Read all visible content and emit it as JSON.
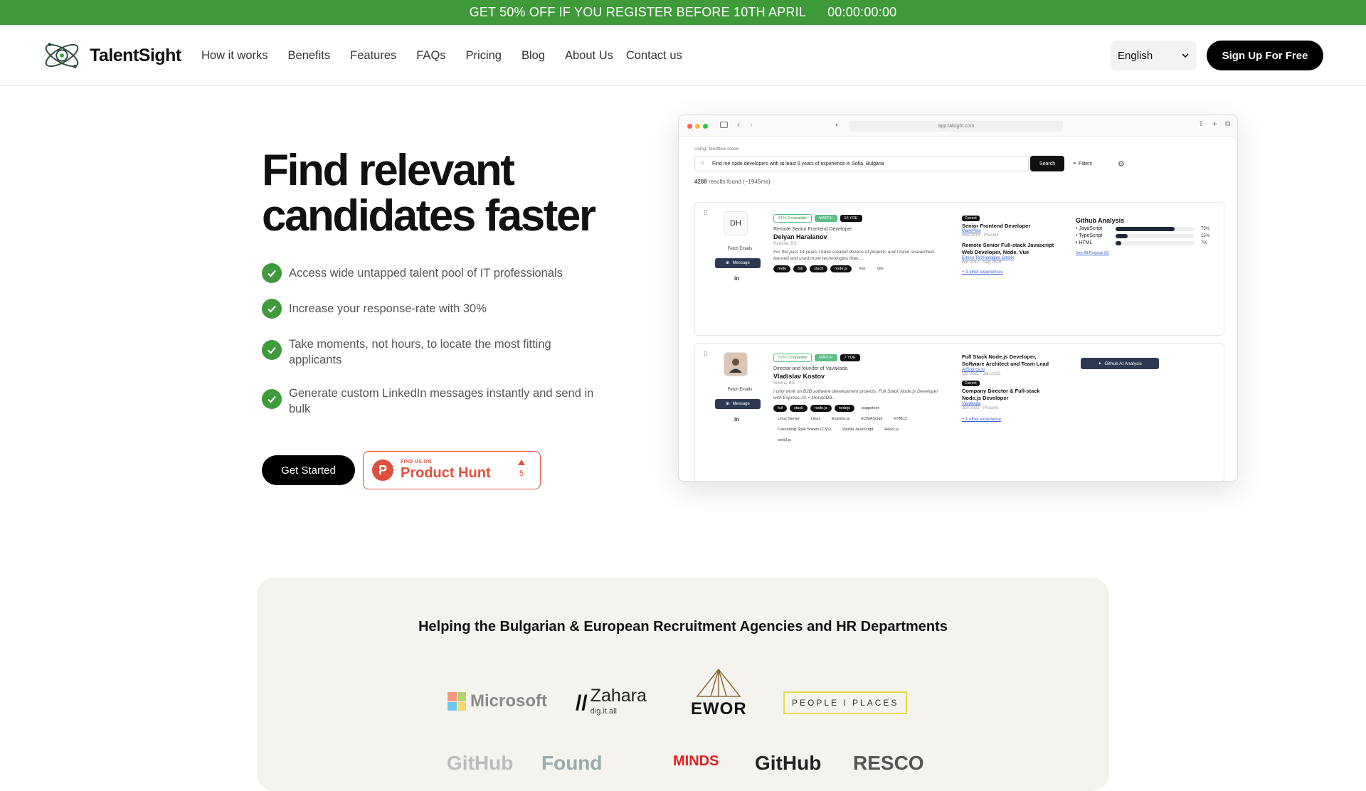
{
  "promo": {
    "text": "GET 50% OFF IF YOU REGISTER BEFORE 10TH APRIL",
    "timer": "00:00:00:00"
  },
  "header": {
    "logo_text": "TalentSight",
    "nav": [
      "How it works",
      "Benefits",
      "Features",
      "FAQs",
      "Pricing",
      "Blog",
      "About Us",
      "Contact us"
    ],
    "language": "English",
    "signup_label": "Sign Up For Free"
  },
  "hero": {
    "title_line1": "Find relevant",
    "title_line2": "candidates faster",
    "features": [
      "Access wide untapped talent pool of IT professionals",
      "Increase your response-rate with 30%",
      "Take moments, not hours, to locate the most fitting applicants",
      "Generate custom LinkedIn messages instantly and send in bulk"
    ],
    "cta_label": "Get Started",
    "product_hunt": {
      "small": "FIND US ON",
      "big": "Product Hunt",
      "votes": "5"
    }
  },
  "app": {
    "url": "app.talsight.com",
    "mode": "Using: feedflow mode",
    "query": "Find me node developers with at least 5 years of experience in Sofia, Bulgaria",
    "search_label": "Search",
    "filters_label": "Filters",
    "results": "4288",
    "results_suffix": "results found (~1945ms)",
    "fetch_label": "Fetch Emails",
    "message_label": "Message",
    "candidates": [
      {
        "initials": "DH",
        "compat": "61% Compatible",
        "match": "MATCH",
        "yoe": "16 YOE",
        "headline": "Remote Senior Frontend Developer",
        "name": "Delyan Haralanov",
        "location": "Remote, BG",
        "desc": "For the past 14 years I have created dozens of projects and I have researched, learned and used more technologies than ...",
        "tags": [
          "node",
          "full",
          "stack",
          "node.js",
          "Vue",
          "Vite"
        ],
        "exp1_badge": "Current",
        "exp1_title": "Senior Frontend Developer",
        "exp1_company": "ManyPets",
        "exp1_dates": "Sep 2019 - Present",
        "exp2_title": "Remote Senior Full-stack Javascript Web Developer, Node, Vue",
        "exp2_company": "Erteco Technologies GmbH",
        "exp2_dates": "Apr 2017 - Aug 2019",
        "more_exp": "+ 3 other experiences",
        "gh_title": "Github Analysis",
        "gh_langs": [
          {
            "name": "JavaScript",
            "pct": "75%",
            "value": 0.75
          },
          {
            "name": "TypeScript",
            "pct": "15%",
            "value": 0.15
          },
          {
            "name": "HTML",
            "pct": "7%",
            "value": 0.07
          }
        ],
        "gh_link": "See All Projects (5)"
      },
      {
        "compat": "57% Compatible",
        "match": "MATCH",
        "yoe": "7 YOE",
        "headline": "Director and founder of Vavakada",
        "name": "Vladislav Kostov",
        "location": "Silistra, BG",
        "desc": "I only work on B2B software development projects. Full Stack Node.js Developer with Express.JS + MongoDB...",
        "tags": [
          "full",
          "stack",
          "node.js",
          "nodejs",
          "puppeteer"
        ],
        "tags2": [
          "Linux Server",
          "Linux",
          "Express.js",
          "ECMAScript",
          "HTML5"
        ],
        "tags3": [
          "Cascading Style Sheets (CSS)",
          "Vanilla JavaScript",
          "React.js"
        ],
        "tags4": [
          "web3.js"
        ],
        "exp1_title": "Full Stack Node.js Developer, Software Architect and Team Lead",
        "exp1_company": "AllSource.io",
        "exp1_dates": "Oct 2021 - Jan 2023",
        "exp2_badge": "Current",
        "exp2_title": "Company Director & Full-stack Node.js Developer",
        "exp2_company": "Vavakada",
        "exp2_dates": "Jun 2021 - Present",
        "more_exp": "+ 1 other experience",
        "gh_button": "Github AI Analysis"
      }
    ]
  },
  "clients": {
    "title": "Helping the Bulgarian & European Recruitment Agencies and HR Departments",
    "logos": [
      "Microsoft",
      "Zahara",
      "dig.it.all",
      "EWOR",
      "PEOPLE I PLACES"
    ],
    "row2": [
      "GitHub",
      "Found",
      "MINDS",
      "GitHub",
      "RESCO"
    ]
  }
}
